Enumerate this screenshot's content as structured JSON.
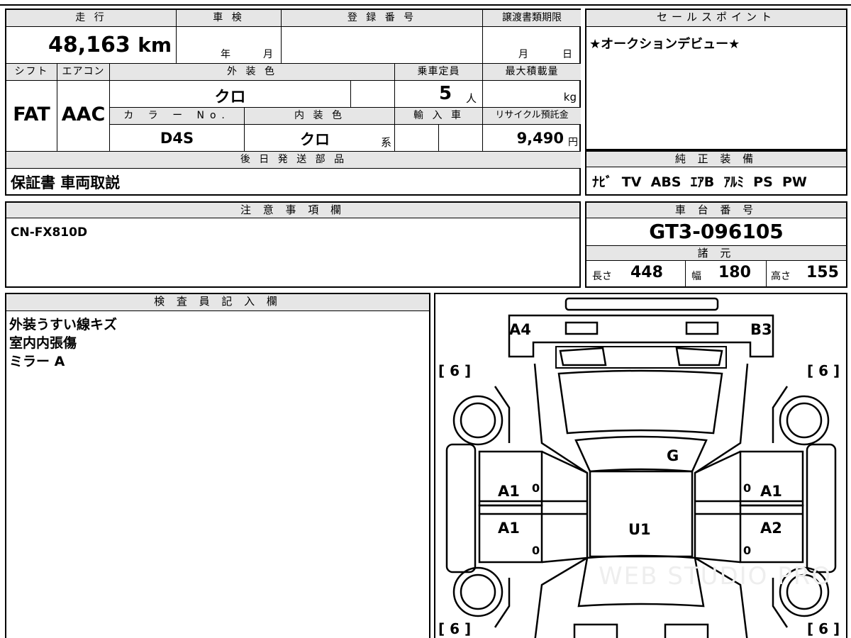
{
  "mileage": {
    "label": "走 行",
    "value": "48,163",
    "unit": "km"
  },
  "inspection": {
    "label": "車 検",
    "year_unit": "年",
    "month_unit": "月"
  },
  "registration": {
    "label": "登 録 番 号"
  },
  "transfer": {
    "label": "譲渡書類期限",
    "month_unit": "月",
    "day_unit": "日"
  },
  "shift": {
    "label": "シフト",
    "value": "FAT"
  },
  "aircon": {
    "label": "エアコン",
    "value": "AAC"
  },
  "exterior_color": {
    "label": "外 装 色",
    "value": "クロ"
  },
  "capacity": {
    "label": "乗車定員",
    "value": "5",
    "unit": "人"
  },
  "max_load": {
    "label": "最大積載量",
    "unit": "kg"
  },
  "color_no": {
    "label": "カ ラ ー No.",
    "value": "D4S"
  },
  "interior_color": {
    "label": "内 装 色",
    "value": "クロ",
    "suffix": "系"
  },
  "import": {
    "label": "輸 入 車"
  },
  "recycle": {
    "label": "リサイクル預託金",
    "value": "9,490",
    "unit": "円"
  },
  "later_parts": {
    "label": "後 日 発 送 部 品",
    "value": "保証書 車両取説"
  },
  "sales_point": {
    "label": "セールスポイント",
    "value": "★オークションデビュー★"
  },
  "genuine_equipment": {
    "label": "純 正 装 備",
    "value": "ﾅﾋﾞ  TV  ABS  ｴｱB  ｱﾙﾐ  PS  PW"
  },
  "notes": {
    "label": "注 意 事 項 欄",
    "value": "CN-FX810D"
  },
  "chassis": {
    "label": "車 台 番 号",
    "value": "GT3-096105"
  },
  "specs": {
    "label": "諸 元",
    "length_label": "長さ",
    "length": "448",
    "width_label": "幅",
    "width": "180",
    "height_label": "高さ",
    "height": "155"
  },
  "inspector": {
    "label": "検 査 員 記 入 欄",
    "lines": [
      "外装うすい線キズ",
      "室内内張傷",
      "ミラー A"
    ]
  },
  "diagram": {
    "marks": {
      "front_left": "A4",
      "front_right": "B3",
      "roof": "G",
      "center": "U1",
      "left_front_door": "A1",
      "left_rear_door": "A1",
      "right_front_door": "A1",
      "right_rear_door": "A2",
      "door_zero": "0"
    },
    "tire_tl": "[ 6 ]",
    "tire_tr": "[ 6 ]",
    "tire_bl": "[ 6 ]",
    "tire_br": "[ 6 ]",
    "watermark": "WEB STUDIO PRO"
  }
}
